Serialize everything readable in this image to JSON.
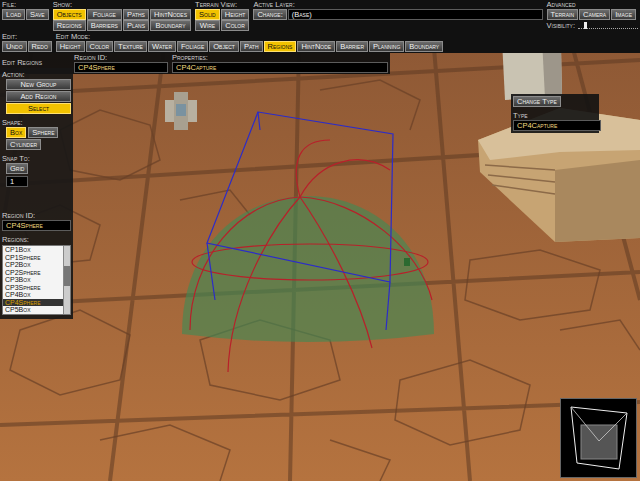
{
  "toolbar": {
    "file": {
      "label": "File:",
      "buttons": [
        {
          "label": "Load",
          "selected": false
        },
        {
          "label": "Save",
          "selected": false
        }
      ]
    },
    "show": {
      "label": "Show:",
      "buttons": [
        {
          "label": "Objects",
          "selected": true
        },
        {
          "label": "Foliage",
          "selected": false
        },
        {
          "label": "Paths",
          "selected": false
        },
        {
          "label": "HintNodes",
          "selected": false
        },
        {
          "label": "Regions",
          "selected": false
        },
        {
          "label": "Barriers",
          "selected": false
        },
        {
          "label": "Plans",
          "selected": false
        },
        {
          "label": "Boundary",
          "selected": false
        }
      ]
    },
    "terrain_view": {
      "label": "Terrain View:",
      "buttons": [
        {
          "label": "Solid",
          "selected": true
        },
        {
          "label": "Height",
          "selected": false
        },
        {
          "label": "Wire",
          "selected": false
        },
        {
          "label": "Color",
          "selected": false
        }
      ]
    },
    "active_layer": {
      "label": "Active Layer:",
      "button": "Change:",
      "value": "(Base)"
    },
    "advanced": {
      "label": "Advanced",
      "buttons": [
        {
          "label": "Terrain",
          "selected": false
        },
        {
          "label": "Camera",
          "selected": false
        },
        {
          "label": "Image",
          "selected": false
        }
      ],
      "visibility": {
        "label": "Visibility:",
        "level": 0.1
      }
    },
    "edit": {
      "label": "Edit:",
      "buttons": [
        {
          "label": "Undo",
          "selected": false
        },
        {
          "label": "Redo",
          "selected": false
        }
      ]
    },
    "edit_mode": {
      "label": "Edit Mode:",
      "buttons": [
        {
          "label": "Height",
          "selected": false
        },
        {
          "label": "Color",
          "selected": false
        },
        {
          "label": "Texture",
          "selected": false
        },
        {
          "label": "Water",
          "selected": false
        },
        {
          "label": "Foliage",
          "selected": false
        },
        {
          "label": "Object",
          "selected": false
        },
        {
          "label": "Path",
          "selected": false
        },
        {
          "label": "Regions",
          "selected": true
        },
        {
          "label": "HintNode",
          "selected": false
        },
        {
          "label": "Barrier",
          "selected": false
        },
        {
          "label": "Planning",
          "selected": false
        },
        {
          "label": "Boundary",
          "selected": false
        }
      ]
    }
  },
  "edit_regions": {
    "title": "Edit Regions",
    "region_id": {
      "label": "Region ID:",
      "value": "CP4Sphere"
    },
    "properties": {
      "label": "Properties:",
      "value": "CP4Capture"
    }
  },
  "sidebar": {
    "action": {
      "label": "Action:",
      "buttons": [
        {
          "label": "New Group",
          "selected": false
        },
        {
          "label": "Add Region",
          "selected": false
        },
        {
          "label": "Select",
          "selected": true
        }
      ]
    },
    "shape": {
      "label": "Shape:",
      "buttons": [
        {
          "label": "Box",
          "selected": true
        },
        {
          "label": "Sphere",
          "selected": false
        },
        {
          "label": "Cylinder",
          "selected": false
        }
      ]
    },
    "snap": {
      "label": "Snap To:",
      "buttons": [
        {
          "label": "Grid",
          "selected": false
        }
      ],
      "value": "1"
    },
    "region_id": {
      "label": "Region ID:",
      "value": "CP4Sphere"
    },
    "regions": {
      "label": "Regions:",
      "items": [
        {
          "label": "CP1Box",
          "selected": false
        },
        {
          "label": "CP1Sphere",
          "selected": false
        },
        {
          "label": "CP2Box",
          "selected": false
        },
        {
          "label": "CP2Sphere",
          "selected": false
        },
        {
          "label": "CP3Box",
          "selected": false
        },
        {
          "label": "CP3Sphere",
          "selected": false
        },
        {
          "label": "CP4Box",
          "selected": false
        },
        {
          "label": "CP4Sphere",
          "selected": true
        },
        {
          "label": "CP5Box",
          "selected": false
        }
      ]
    }
  },
  "type_panel": {
    "button": "Change Type",
    "label": "Type",
    "value": "CP4Capture"
  }
}
